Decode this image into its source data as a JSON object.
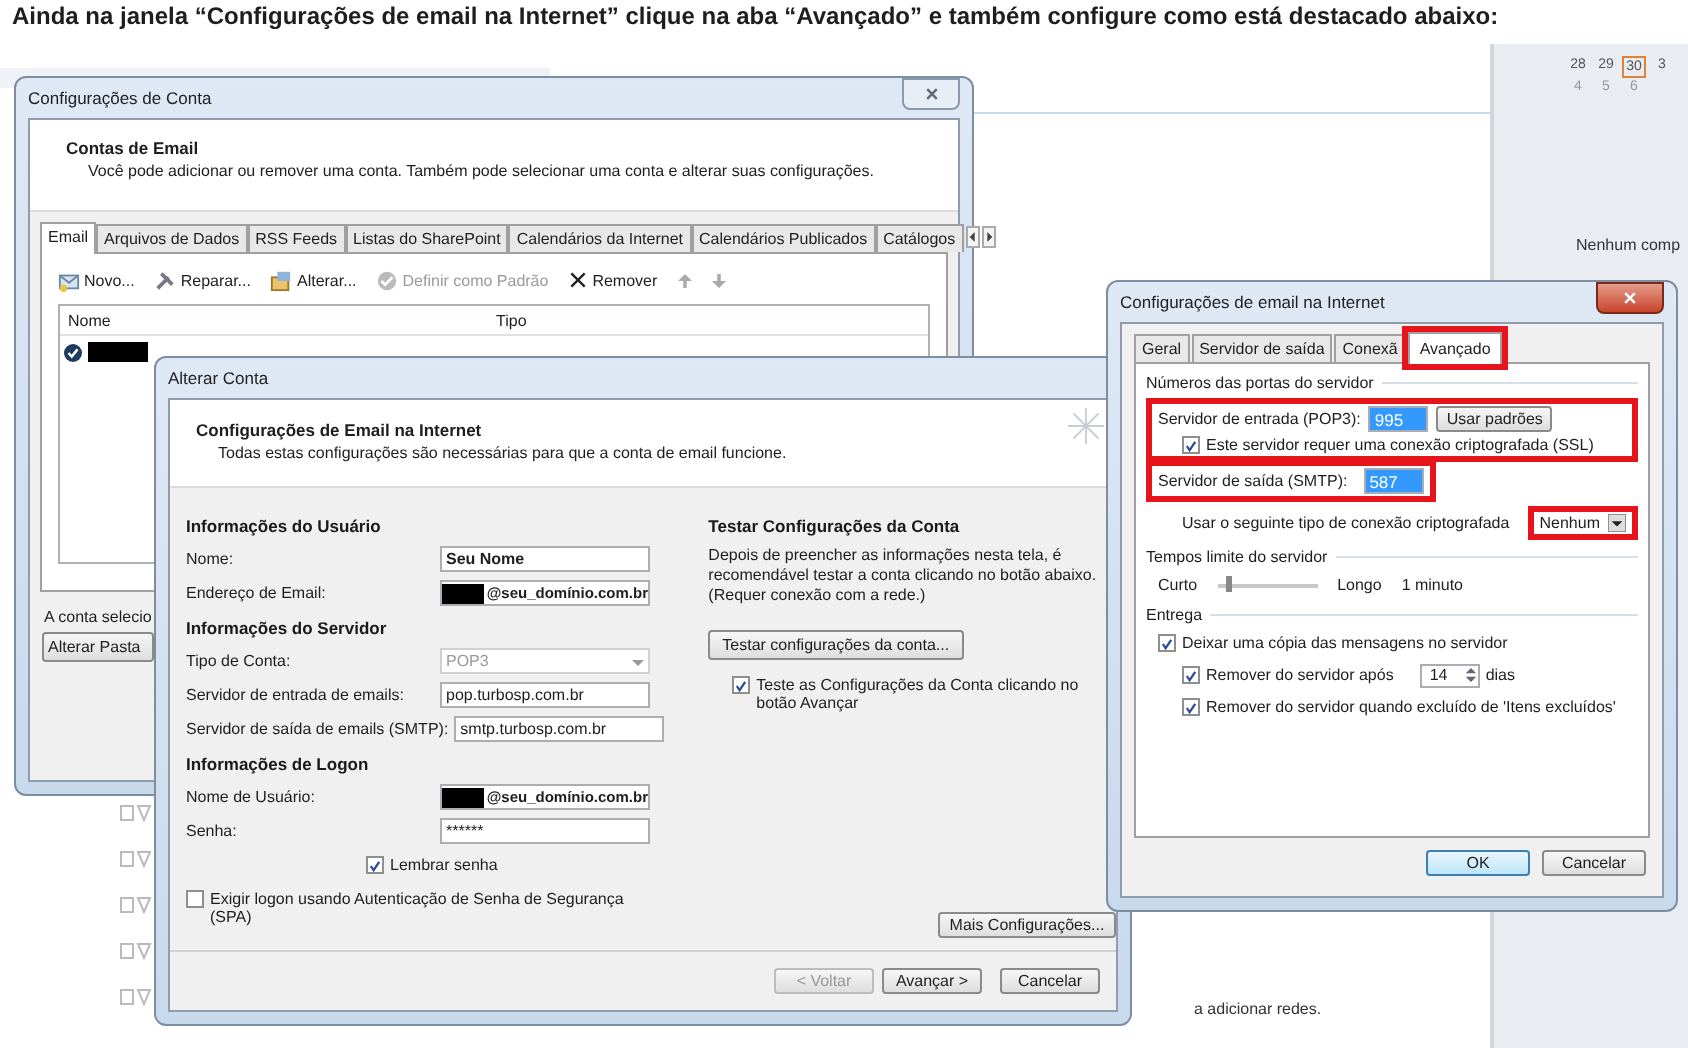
{
  "heading": "Ainda na janela “Configurações de email na Internet” clique na aba “Avançado” e também configure como está destacado abaixo:",
  "background": {
    "calendar_weeks": [
      [
        {
          "label": "28",
          "selected": false
        },
        {
          "label": "29",
          "selected": false
        },
        {
          "label": "30",
          "selected": true
        },
        {
          "label": "3",
          "selected": false
        }
      ],
      [
        {
          "label": "4",
          "selected": false
        },
        {
          "label": "5",
          "selected": false
        },
        {
          "label": "6",
          "selected": false
        }
      ]
    ],
    "notice": "Nenhum comp",
    "footer_text": "a adicionar redes."
  },
  "account_settings": {
    "title": "Configurações de Conta",
    "header_title": "Contas de Email",
    "header_subtitle": "Você pode adicionar ou remover uma conta. Também pode selecionar uma conta e alterar suas configurações.",
    "tabs": [
      {
        "label": "Email",
        "selected": true
      },
      {
        "label": "Arquivos de Dados",
        "selected": false
      },
      {
        "label": "RSS Feeds",
        "selected": false
      },
      {
        "label": "Listas do SharePoint",
        "selected": false
      },
      {
        "label": "Calendários da Internet",
        "selected": false
      },
      {
        "label": "Calendários Publicados",
        "selected": false
      },
      {
        "label": "Catálogos",
        "selected": false
      }
    ],
    "toolbar": [
      {
        "kind": "new",
        "label": "Novo...",
        "disabled": false
      },
      {
        "kind": "repair",
        "label": "Reparar...",
        "disabled": false
      },
      {
        "kind": "change",
        "label": "Alterar...",
        "disabled": false
      },
      {
        "kind": "default",
        "label": "Definir como Padrão",
        "disabled": true
      },
      {
        "kind": "remove",
        "label": "Remover",
        "disabled": false
      }
    ],
    "columns": [
      "Nome",
      "Tipo"
    ],
    "status_text": "A conta selecio",
    "folder_button": "Alterar Pasta"
  },
  "change_account": {
    "title": "Alterar Conta",
    "header_title": "Configurações de Email na Internet",
    "header_subtitle": "Todas estas configurações são necessárias para que a conta de email funcione.",
    "form": [
      {
        "kind": "heading",
        "text": "Informações do Usuário"
      },
      {
        "kind": "field",
        "label": "Nome:",
        "value": "Seu Nome",
        "bold": true
      },
      {
        "kind": "redacted_field",
        "label": "Endereço de Email:",
        "value": "@seu_domínio.com.br",
        "bold": true
      },
      {
        "kind": "heading",
        "text": "Informações do Servidor"
      },
      {
        "kind": "select",
        "label": "Tipo de Conta:",
        "value": "POP3",
        "disabled": true
      },
      {
        "kind": "field",
        "label": "Servidor de entrada de emails:",
        "value": "pop.turbosp.com.br",
        "bold": false
      },
      {
        "kind": "field",
        "label": "Servidor de saída de emails (SMTP):",
        "value": "smtp.turbosp.com.br",
        "bold": false
      },
      {
        "kind": "heading",
        "text": "Informações de Logon"
      },
      {
        "kind": "redacted_field",
        "label": "Nome de Usuário:",
        "value": "@seu_domínio.com.br",
        "bold": true
      },
      {
        "kind": "field",
        "label": "Senha:",
        "value": "******",
        "bold": false
      }
    ],
    "remember": {
      "label": "Lembrar senha",
      "checked": true
    },
    "spa": {
      "label": "Exigir logon usando Autenticação de Senha de Segurança (SPA)",
      "checked": false
    },
    "test_title": "Testar Configurações da Conta",
    "test_text": "Depois de preencher as informações nesta tela, é recomendável testar a conta clicando no botão abaixo. (Requer conexão com a rede.)",
    "test_button": "Testar configurações da conta...",
    "test_check": {
      "label": "Teste as Configurações da Conta clicando no botão Avançar",
      "checked": true
    },
    "more_button": "Mais Configurações...",
    "buttons": [
      {
        "label": "< Voltar",
        "disabled": true
      },
      {
        "label": "Avançar >",
        "disabled": false
      },
      {
        "label": "Cancelar",
        "disabled": false
      }
    ]
  },
  "internet_settings": {
    "title": "Configurações de email na Internet",
    "tabs": [
      {
        "label": "Geral",
        "selected": false,
        "highlighted": false
      },
      {
        "label": "Servidor de saída",
        "selected": false,
        "highlighted": false
      },
      {
        "label": "Conexã",
        "selected": false,
        "highlighted": false
      },
      {
        "label": "Avançado",
        "selected": true,
        "highlighted": true
      }
    ],
    "ports_group": "Números das portas do servidor",
    "incoming": {
      "label": "Servidor de entrada (POP3):",
      "value": "995",
      "value_selected": true,
      "button": "Usar padrões",
      "highlighted": true,
      "ssl": {
        "label": "Este servidor requer uma conexão criptografada (SSL)",
        "checked": true
      }
    },
    "outgoing": {
      "label": "Servidor de saída (SMTP):",
      "value": "587",
      "value_selected": true,
      "highlighted": true
    },
    "encryption": {
      "label": "Usar o seguinte tipo de conexão criptografada",
      "value": "Nenhum",
      "highlighted": true
    },
    "timeouts_group": "Tempos limite do servidor",
    "timeout": {
      "min_label": "Curto",
      "max_label": "Longo",
      "level": 0.1,
      "reading": "1 minuto"
    },
    "delivery_group": "Entrega",
    "delivery": [
      {
        "kind": "check",
        "label": "Deixar uma cópia das mensagens no servidor",
        "checked": true,
        "children": [
          {
            "kind": "days",
            "label": "Remover do servidor após",
            "checked": true,
            "value": "14",
            "unit": "dias"
          },
          {
            "kind": "check",
            "label": "Remover do servidor quando excluído de 'Itens excluídos'",
            "checked": true
          }
        ]
      }
    ],
    "buttons": [
      {
        "label": "OK",
        "default": true
      },
      {
        "label": "Cancelar",
        "default": false
      }
    ]
  }
}
